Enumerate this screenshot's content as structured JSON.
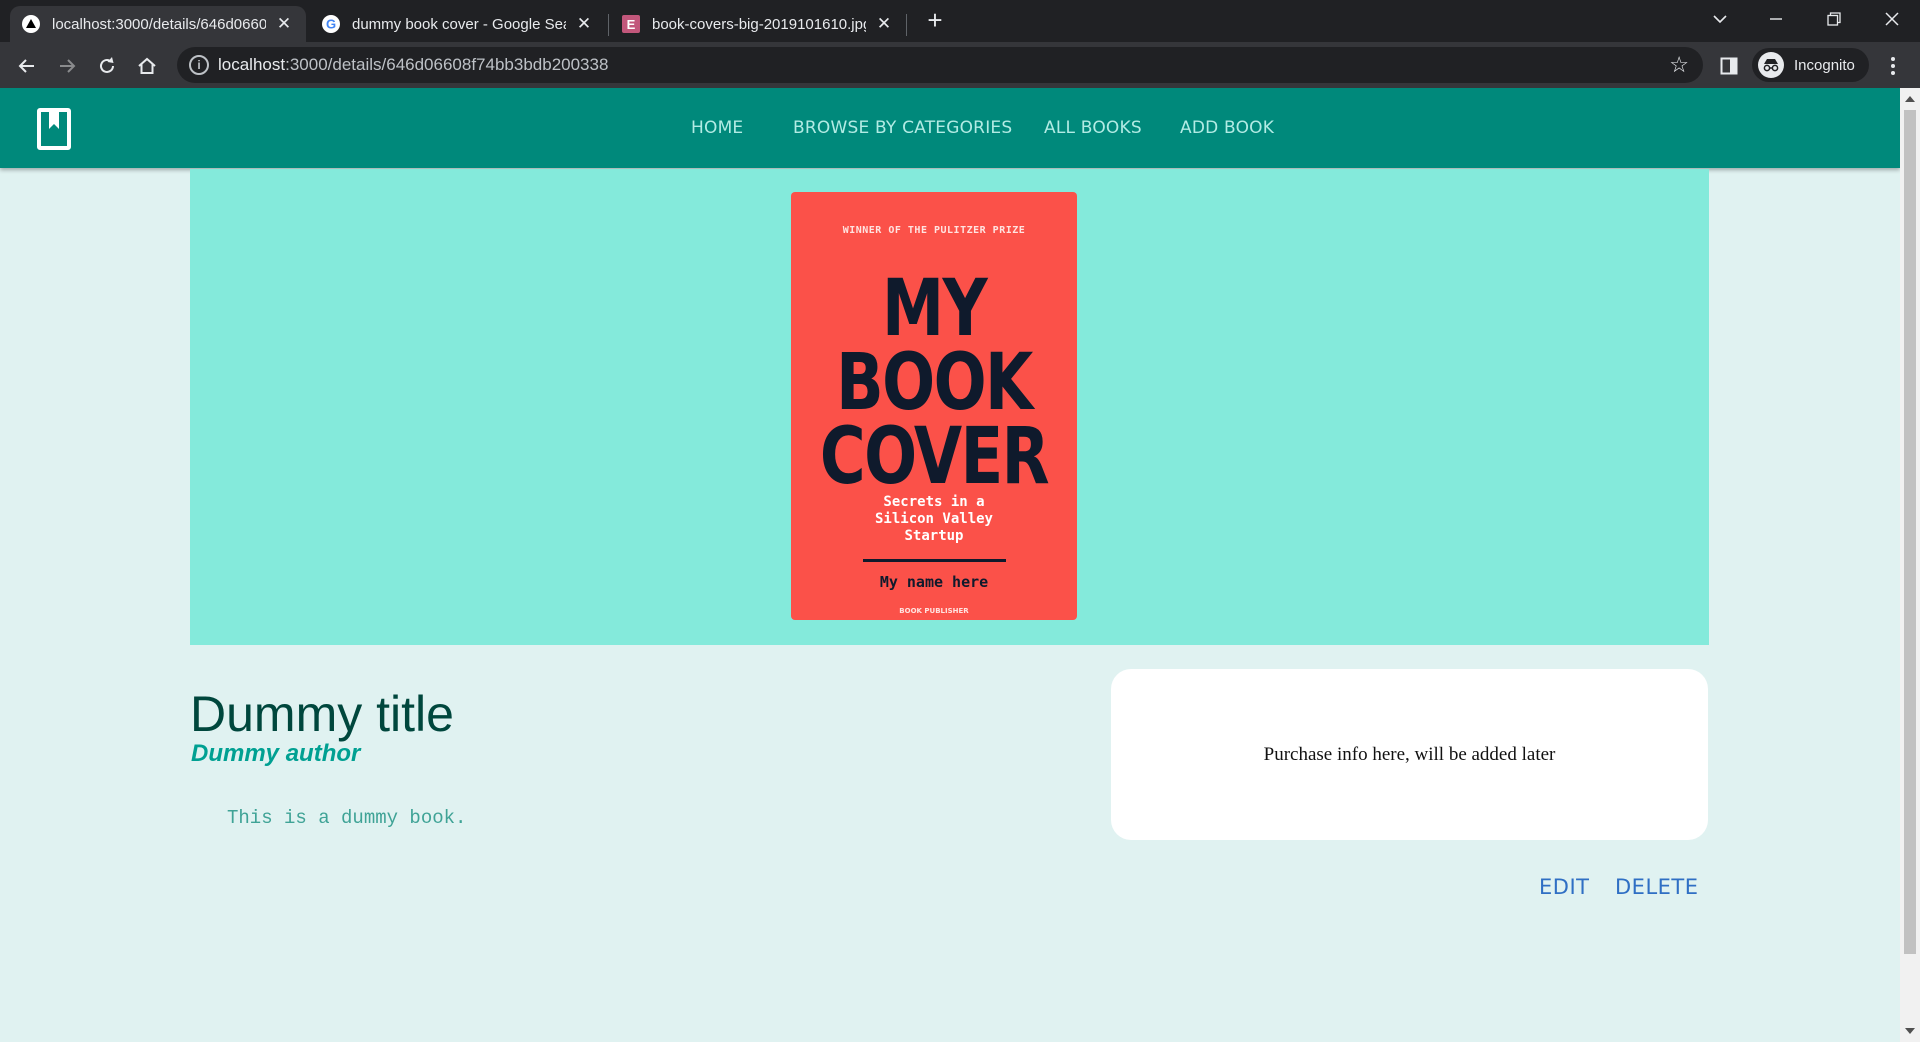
{
  "browser": {
    "tabs": [
      {
        "title": "localhost:3000/details/646d0660",
        "active": true,
        "favicon": "triangle-icon"
      },
      {
        "title": "dummy book cover - Google Sea",
        "active": false,
        "favicon": "google-icon"
      },
      {
        "title": "book-covers-big-2019101610.jpg",
        "active": false,
        "favicon": "e-icon"
      }
    ],
    "tab_close_glyph": "✕",
    "new_tab_glyph": "+",
    "url_host": "localhost",
    "url_path": ":3000/details/646d06608f74bb3bdb200338",
    "profile_label": "Incognito"
  },
  "app": {
    "nav": {
      "home": "HOME",
      "browse": "BROWSE BY CATEGORIES",
      "all_books": "ALL BOOKS",
      "add_book": "ADD BOOK"
    },
    "cover": {
      "prize_line": "WINNER OF THE PULITZER PRIZE",
      "line1": "MY",
      "line2": "BOOK",
      "line3": "COVER",
      "subtitle_1": "Secrets in a",
      "subtitle_2": "Silicon Valley",
      "subtitle_3": "Startup",
      "author": "My name here",
      "publisher": "BOOK PUBLISHER"
    },
    "book": {
      "title": "Dummy title",
      "author": "Dummy author",
      "description": "This is a dummy book."
    },
    "purchase_info": "Purchase info here, will be added later",
    "actions": {
      "edit": "EDIT",
      "delete": "DELETE"
    },
    "colors": {
      "appbar": "#00897b",
      "hero": "#84eadb",
      "page_bg": "#e0f2f1",
      "cover": "#fb5149",
      "action_link": "#2f6fc4"
    }
  }
}
